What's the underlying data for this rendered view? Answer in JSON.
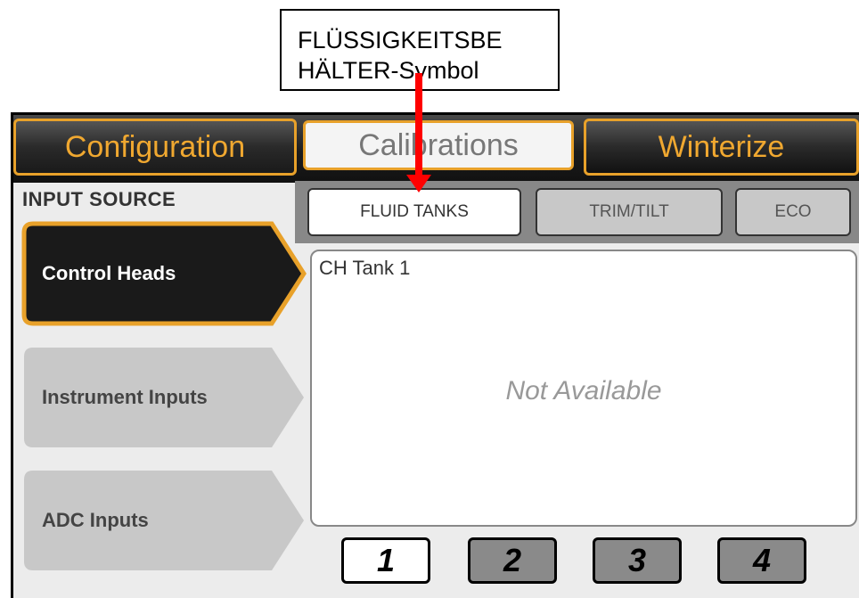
{
  "callout": {
    "line1": "FLÜSSIGKEITSBE",
    "line2": "HÄLTER-Symbol"
  },
  "tabs": {
    "configuration": "Configuration",
    "calibrations": "Calibrations",
    "winterize": "Winterize"
  },
  "input_source": {
    "heading": "INPUT SOURCE",
    "items": [
      "Control Heads",
      "Instrument Inputs",
      "ADC Inputs"
    ],
    "selected": "Control Heads"
  },
  "sub_tabs": {
    "fluid_tanks": "FLUID TANKS",
    "trim_tilt": "TRIM/TILT",
    "eco": "ECO",
    "selected": "FLUID TANKS"
  },
  "panel": {
    "title": "CH Tank 1",
    "message": "Not Available"
  },
  "pages": [
    "1",
    "2",
    "3",
    "4"
  ],
  "colors": {
    "accent_orange": "#e8a12a",
    "annotation_red": "#ff0000",
    "selected_dark": "#1a1a1a",
    "unselected_gray": "#c8c8c8"
  }
}
